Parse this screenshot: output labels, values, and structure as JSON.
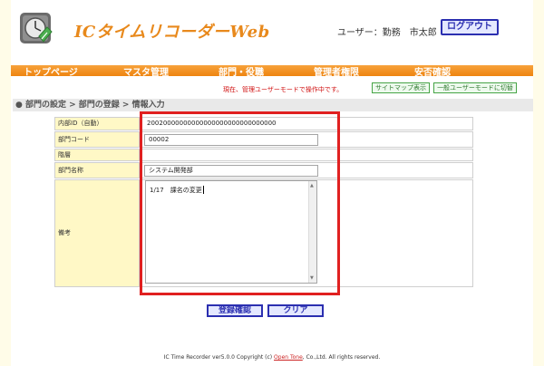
{
  "header": {
    "app_title": "ICタイムリコーダーWeb",
    "user_label": "ユーザー：勤務　市太郎",
    "logout_label": "ログアウト"
  },
  "nav": {
    "items": [
      {
        "label": "トップページ"
      },
      {
        "label": "マスタ管理"
      },
      {
        "label": "部門・役職"
      },
      {
        "label": "管理者権限"
      },
      {
        "label": "安否確認"
      }
    ]
  },
  "mode_notice": "現在、管理ユーザーモードで操作中です。",
  "sitemap_label": "サイトマップ表示",
  "switch_mode_label": "一般ユーザーモードに切替",
  "breadcrumb": "● 部門の設定 > 部門の登録 > 情報入力",
  "form": {
    "rows": [
      {
        "label": "内部ID（自動）",
        "value": "20020000000000000000000000000000"
      },
      {
        "label": "部門コード",
        "value": "00002"
      },
      {
        "label": "階層",
        "value": ""
      },
      {
        "label": "部門名称",
        "value": "システム開発部"
      },
      {
        "label": "備考",
        "value": "1/17　課名の変更"
      }
    ]
  },
  "actions": {
    "confirm_label": "登録確認",
    "clear_label": "クリア"
  },
  "footer": {
    "prefix": "IC Time Recorder ver5.0.0 Copyright (c)",
    "link": "Open Tone",
    "suffix": ", Co.,Ltd. All rights reserved."
  },
  "colors": {
    "accent": "#ee8410",
    "highlight": "#e02020",
    "button_border": "#2b2fb0",
    "label_bg": "#fff8c6"
  }
}
